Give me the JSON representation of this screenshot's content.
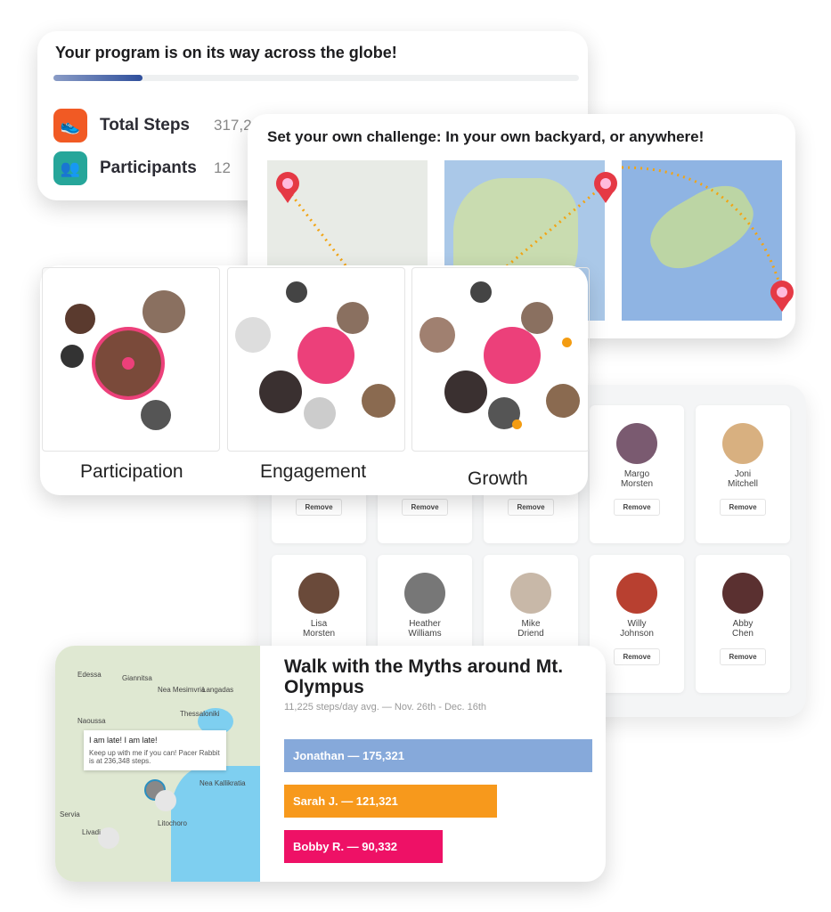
{
  "progress_card": {
    "title": "Your program is on its way across the globe!",
    "progress_percent": 17,
    "stats": [
      {
        "label": "Total Steps",
        "value": "317,2",
        "icon": "shoe-icon",
        "color": "#f15a24"
      },
      {
        "label": "Participants",
        "value": "12",
        "icon": "people-icon",
        "color": "#26a69a"
      }
    ]
  },
  "challenge_card": {
    "title": "Set your own challenge: In your own backyard, or anywhere!",
    "pin_color": "#e53945",
    "route_color": "#f2a413"
  },
  "metrics_card": {
    "panels": [
      {
        "label": "Participation"
      },
      {
        "label": "Engagement"
      },
      {
        "label": "Growth"
      }
    ],
    "accent": "#ec407a",
    "check_color": "#f39c12"
  },
  "participants_grid": {
    "remove_label": "Remove",
    "people": [
      {
        "first": "",
        "last": ""
      },
      {
        "first": "",
        "last": ""
      },
      {
        "first": "",
        "last": ""
      },
      {
        "first": "Margo",
        "last": "Morsten"
      },
      {
        "first": "Joni",
        "last": "Mitchell"
      },
      {
        "first": "Lisa",
        "last": "Morsten"
      },
      {
        "first": "Heather",
        "last": "Williams"
      },
      {
        "first": "Mike",
        "last": "Driend"
      },
      {
        "first": "Willy",
        "last": "Johnson"
      },
      {
        "first": "Abby",
        "last": "Chen"
      }
    ]
  },
  "myth_card": {
    "title": "Walk with the Myths around Mt. Olympus",
    "subtitle": "11,225 steps/day avg. — Nov. 26th - Dec. 16th",
    "tooltip": {
      "title": "I am late! I am late!",
      "body": "Keep up with me if you can! Pacer Rabbit is at 236,348 steps."
    },
    "towns": [
      "Edessa",
      "Giannitsa",
      "Nea Mesimvria",
      "Langadas",
      "Thessaloniki",
      "Naoussa",
      "Nea Kallikratia",
      "Servia",
      "Livadi",
      "Litochoro"
    ],
    "leaders": [
      {
        "label": "Jonathan — 175,321",
        "steps": 175321,
        "color": "#86a9da"
      },
      {
        "label": "Sarah J. — 121,321",
        "steps": 121321,
        "color": "#f7991c"
      },
      {
        "label": "Bobby R. — 90,332",
        "steps": 90332,
        "color": "#ee1166"
      }
    ]
  }
}
